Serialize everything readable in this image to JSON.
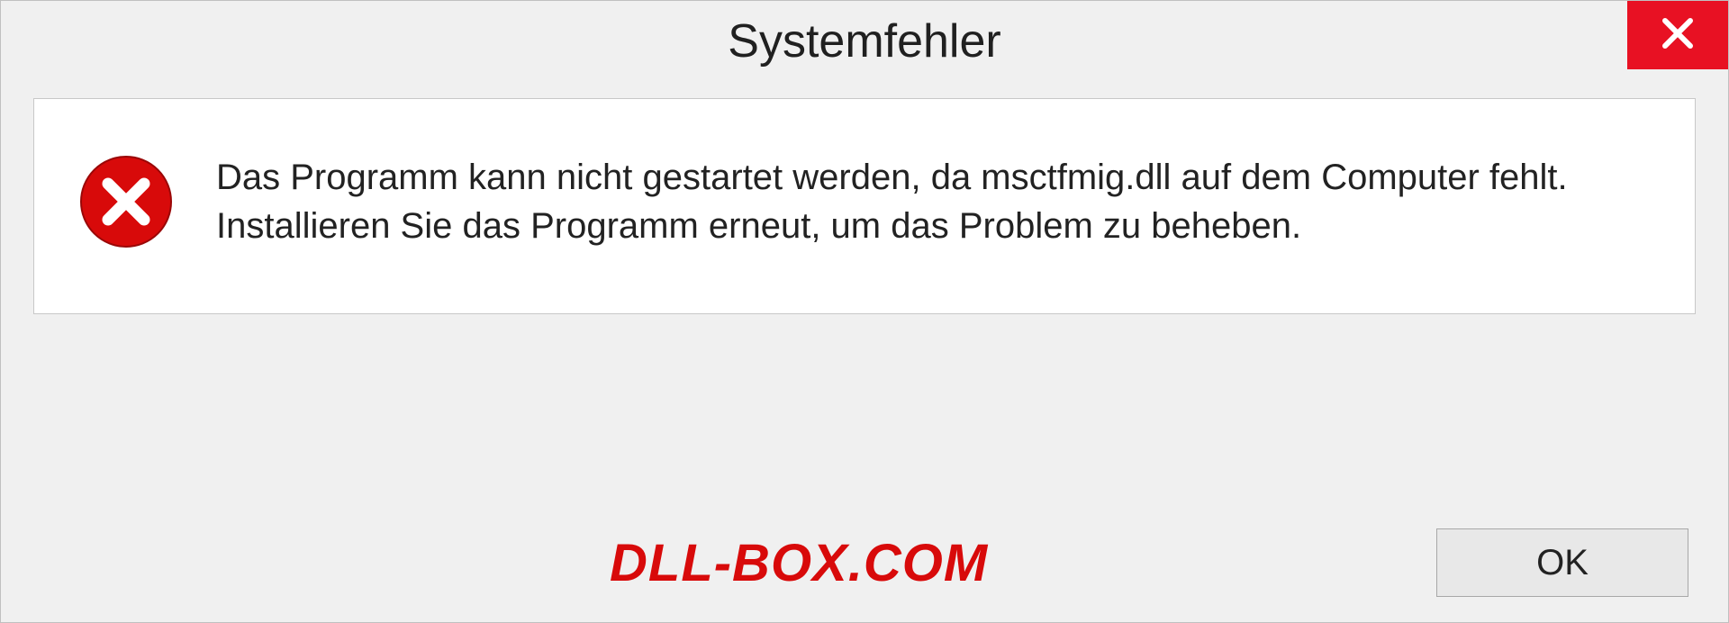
{
  "dialog": {
    "title": "Systemfehler",
    "message": "Das Programm kann nicht gestartet werden, da msctfmig.dll auf dem Computer fehlt. Installieren Sie das Programm erneut, um das Problem zu beheben.",
    "ok_label": "OK"
  },
  "watermark": "DLL-BOX.COM"
}
